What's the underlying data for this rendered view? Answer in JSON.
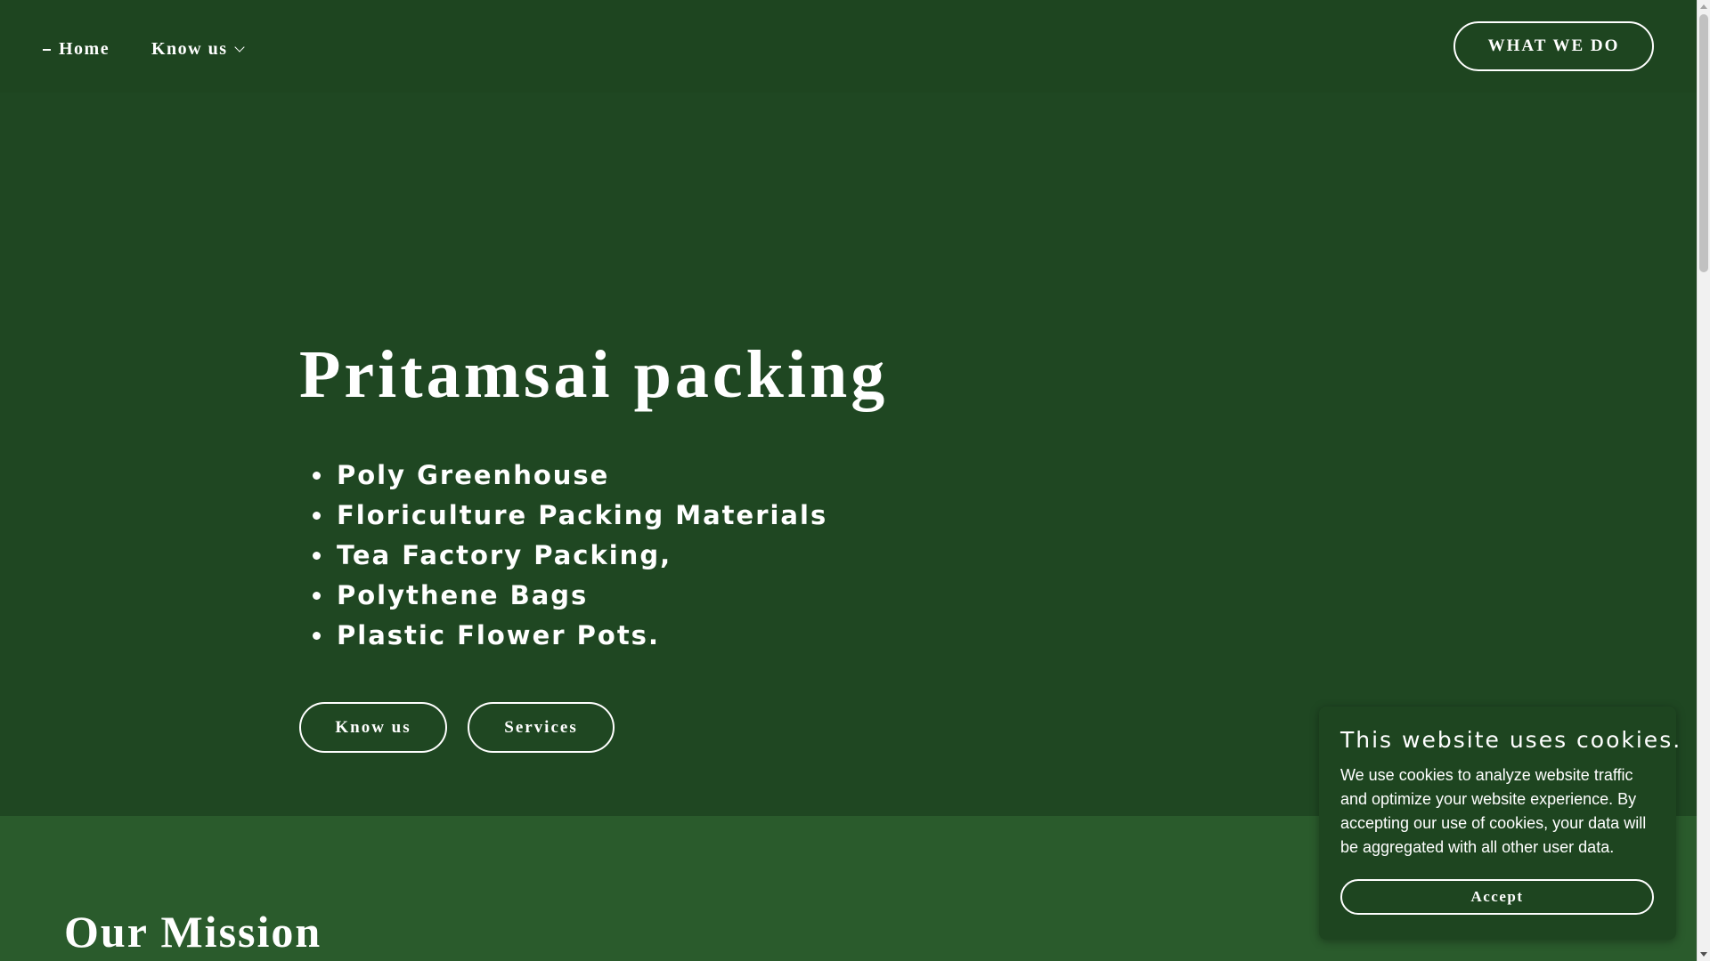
{
  "header": {
    "nav": {
      "home_label": "Home",
      "know_us_label": "Know us"
    },
    "cta_label": "WHAT WE DO"
  },
  "hero": {
    "title": "Pritamsai packing",
    "items": [
      "Poly Greenhouse",
      "Floriculture Packing Materials",
      "Tea Factory Packing,",
      "Polythene Bags",
      "Plastic Flower Pots."
    ],
    "buttons": {
      "know_us": "Know us",
      "services": "Services"
    }
  },
  "mission": {
    "title": "Our Mission"
  },
  "cookie_banner": {
    "title": "This website uses cookies.",
    "body": "We use cookies to analyze website traffic and optimize your website experience. By accepting our use of cookies, your data will be aggregated with all other user data.",
    "accept_label": "Accept"
  },
  "colors": {
    "hero_background": "#1f4722",
    "mission_background": "#2a5b2c",
    "text": "#ffffff"
  },
  "icons": {
    "nav_active": "dash-icon",
    "dropdown": "chevron-down-icon"
  }
}
